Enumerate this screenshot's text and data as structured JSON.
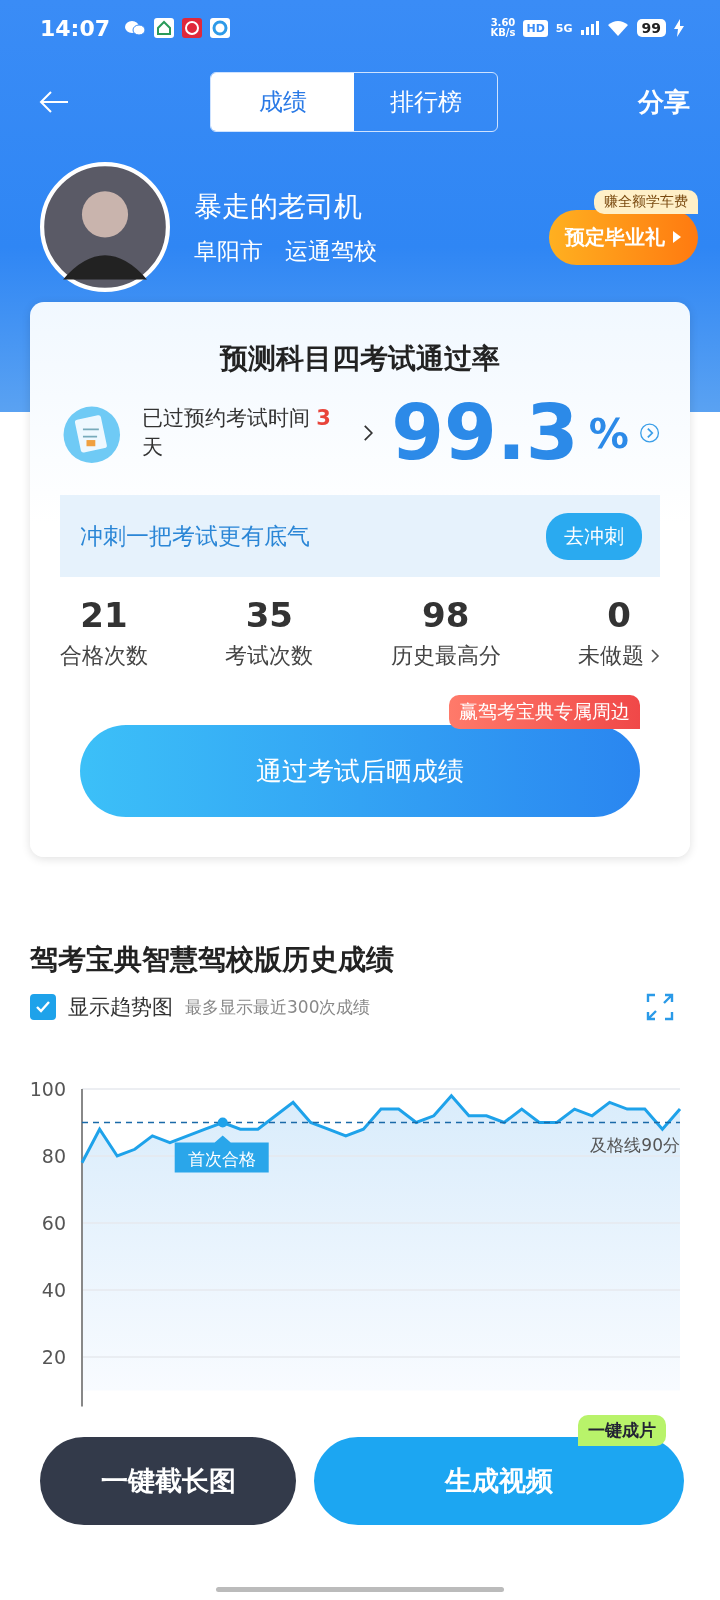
{
  "status_bar": {
    "time": "14:07",
    "speed": "3.60",
    "speed_unit": "KB/s",
    "hd": "HD",
    "network": "5G",
    "battery": "99"
  },
  "header": {
    "tabs": [
      {
        "label": "成绩",
        "selected": true
      },
      {
        "label": "排行榜",
        "selected": false
      }
    ],
    "share": "分享"
  },
  "profile": {
    "name": "暴走的老司机",
    "city": "阜阳市",
    "school": "运通驾校",
    "promo_badge": "赚全额学车费",
    "promo_button": "预定毕业礼"
  },
  "prediction": {
    "title": "预测科目四考试通过率",
    "notice_prefix": "已过预约考试时间",
    "notice_days": "3",
    "notice_suffix": "天",
    "rate": "99.3",
    "rate_unit": "%",
    "sprint_text": "冲刺一把考试更有底气",
    "sprint_button": "去冲刺",
    "stats": [
      {
        "value": "21",
        "label": "合格次数",
        "has_arrow": false
      },
      {
        "value": "35",
        "label": "考试次数",
        "has_arrow": false
      },
      {
        "value": "98",
        "label": "历史最高分",
        "has_arrow": false
      },
      {
        "value": "0",
        "label": "未做题",
        "has_arrow": true
      }
    ],
    "merch_badge": "赢驾考宝典专属周边",
    "share_button": "通过考试后晒成绩"
  },
  "history": {
    "title": "驾考宝典智慧驾校版历史成绩",
    "show_trend": {
      "label": "显示趋势图",
      "checked": true
    },
    "hint": "最多显示最近300次成绩",
    "chart_data": {
      "type": "line",
      "grid": true,
      "ylim": [
        10,
        100
      ],
      "yticks": [
        20,
        40,
        60,
        80,
        100
      ],
      "series": [
        {
          "color": "#1ea2ea",
          "values": [
            78,
            88,
            80,
            82,
            86,
            84,
            null,
            null,
            90,
            88,
            88,
            92,
            96,
            90,
            88,
            86,
            88,
            94,
            94,
            90,
            92,
            98,
            92,
            92,
            90,
            94,
            90,
            90,
            94,
            92,
            96,
            94,
            94,
            88,
            94
          ]
        }
      ],
      "ref_lines": [
        {
          "axis": "y",
          "value": 90,
          "label": "及格线90分",
          "color": "#1a6aa8"
        }
      ],
      "annotations": [
        "首次合格"
      ]
    }
  },
  "bottom": {
    "long_shot_button": "一键截长图",
    "video_button": "生成视频",
    "video_badge": "一键成片"
  }
}
